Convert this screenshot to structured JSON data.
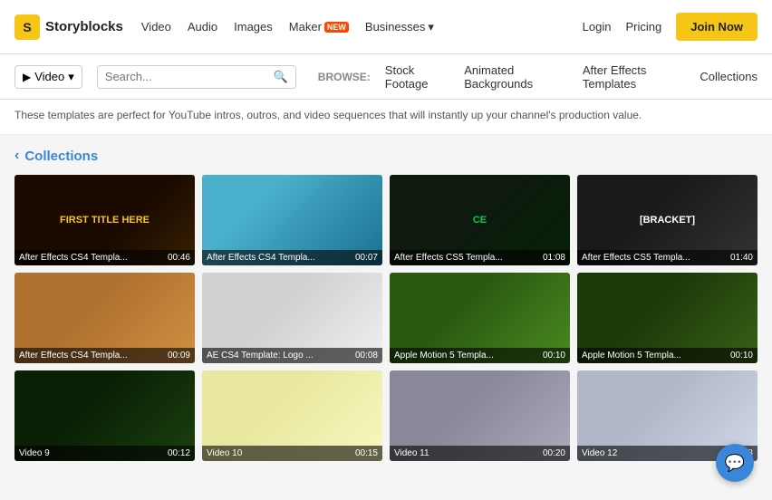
{
  "header": {
    "logo_initial": "S",
    "logo_name": "Storyblocks",
    "nav_items": [
      {
        "label": "Video",
        "badge": null
      },
      {
        "label": "Audio",
        "badge": null
      },
      {
        "label": "Images",
        "badge": null
      },
      {
        "label": "Maker",
        "badge": "NEW"
      },
      {
        "label": "Businesses",
        "badge": null,
        "has_arrow": true
      }
    ],
    "login_label": "Login",
    "pricing_label": "Pricing",
    "join_label": "Join Now"
  },
  "search": {
    "dropdown_label": "Video",
    "placeholder": "Search...",
    "browse_label": "BROWSE:",
    "browse_links": [
      "Stock Footage",
      "Animated Backgrounds",
      "After Effects Templates",
      "Collections"
    ]
  },
  "description": "These templates are perfect for YouTube intros, outros, and video sequences that will instantly up your channel's production value.",
  "collections": {
    "back_label": "‹",
    "title": "Collections",
    "videos": [
      {
        "title": "After Effects CS4 Templa...",
        "duration": "00:46",
        "bg": "#1a0a00",
        "accent": "#c8a000",
        "text": "FIRST TITLE HERE"
      },
      {
        "title": "After Effects CS4 Templa...",
        "duration": "00:07",
        "bg": "#5ab3cc",
        "accent": "#d0e8f0",
        "text": ""
      },
      {
        "title": "After Effects CS5 Templa...",
        "duration": "01:08",
        "bg": "#0d1a0d",
        "accent": "#00aa44",
        "text": "CE"
      },
      {
        "title": "After Effects CS5 Templa...",
        "duration": "01:40",
        "bg": "#1a1a1a",
        "accent": "#dddddd",
        "text": "[BRACKET]"
      },
      {
        "title": "After Effects CS4 Templa...",
        "duration": "00:09",
        "bg": "#c0803a",
        "accent": "#f0c070",
        "text": ""
      },
      {
        "title": "AE CS4 Template: Logo ...",
        "duration": "00:08",
        "bg": "#e8e8e8",
        "accent": "#888",
        "text": ""
      },
      {
        "title": "Apple Motion 5 Templa...",
        "duration": "00:10",
        "bg": "#3a6a1a",
        "accent": "#88cc44",
        "text": ""
      },
      {
        "title": "Apple Motion 5 Templa...",
        "duration": "00:10",
        "bg": "#2a4a0a",
        "accent": "#66aa22",
        "text": ""
      },
      {
        "title": "Video 9",
        "duration": "00:12",
        "bg": "#1a3a0a",
        "accent": "#449922",
        "text": ""
      },
      {
        "title": "Video 10",
        "duration": "00:15",
        "bg": "#f0f0c0",
        "accent": "#cccc00",
        "text": ""
      },
      {
        "title": "Video 11",
        "duration": "00:20",
        "bg": "#c0c0c0",
        "accent": "#888888",
        "text": ""
      },
      {
        "title": "Video 12",
        "duration": "00:18",
        "bg": "#d0d8e0",
        "accent": "#aaaacc",
        "text": ""
      }
    ]
  }
}
